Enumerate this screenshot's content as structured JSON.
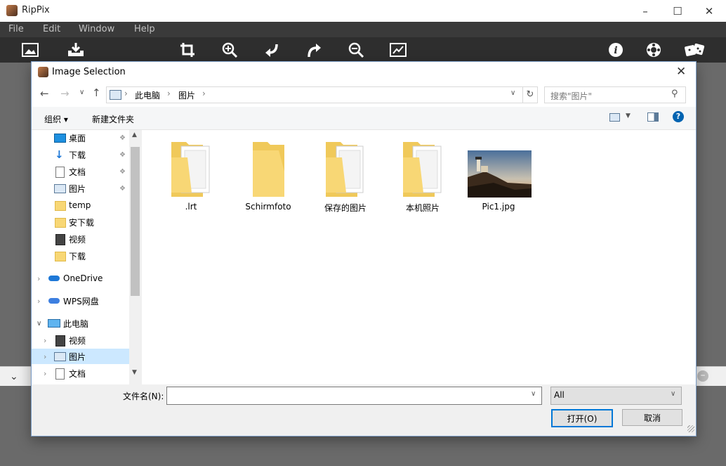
{
  "app": {
    "title": "RipPix",
    "menu": [
      "File",
      "Edit",
      "Window",
      "Help"
    ]
  },
  "dialog": {
    "title": "Image Selection",
    "breadcrumb": [
      "此电脑",
      "图片"
    ],
    "search_placeholder": "搜索\"图片\"",
    "organize_label": "组织 ▾",
    "new_folder_label": "新建文件夹",
    "nav_items": [
      {
        "label": "桌面",
        "icon": "desktop-icon",
        "pinned": true
      },
      {
        "label": "下载",
        "icon": "download-icon",
        "pinned": true
      },
      {
        "label": "文档",
        "icon": "document-icon",
        "pinned": true
      },
      {
        "label": "图片",
        "icon": "picture-icon",
        "pinned": true
      },
      {
        "label": "temp",
        "icon": "folder-icon",
        "pinned": false
      },
      {
        "label": "安下载",
        "icon": "folder-icon",
        "pinned": false
      },
      {
        "label": "视频",
        "icon": "video-icon",
        "pinned": false
      },
      {
        "label": "下载",
        "icon": "folder-icon",
        "pinned": false
      },
      {
        "label": "OneDrive",
        "icon": "cloud-icon",
        "pinned": false
      },
      {
        "label": "WPS网盘",
        "icon": "cloud-icon",
        "pinned": false
      },
      {
        "label": "此电脑",
        "icon": "computer-icon",
        "pinned": false
      },
      {
        "label": "视频",
        "icon": "video-icon",
        "pinned": false
      },
      {
        "label": "图片",
        "icon": "picture-icon",
        "pinned": false
      },
      {
        "label": "文档",
        "icon": "document-icon",
        "pinned": false
      }
    ],
    "files": [
      {
        "name": ".lrt",
        "type": "folder-docs"
      },
      {
        "name": "Schirmfoto",
        "type": "folder"
      },
      {
        "name": "保存的图片",
        "type": "folder-docs"
      },
      {
        "name": "本机照片",
        "type": "folder-docs"
      },
      {
        "name": "Pic1.jpg",
        "type": "image"
      }
    ],
    "filename_label": "文件名(N):",
    "filename_value": "",
    "filter_value": "All",
    "open_label": "打开(O)",
    "cancel_label": "取消"
  },
  "colors": {
    "accent": "#0078d7",
    "folder": "#f8d775",
    "selection": "#cce8ff"
  }
}
